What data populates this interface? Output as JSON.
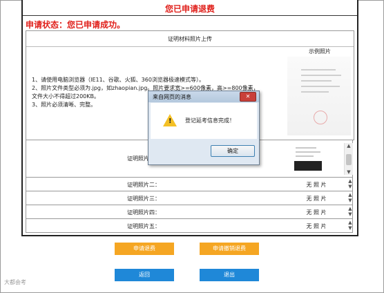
{
  "page": {
    "title": "您已申请退费",
    "status": "申请状态：您已申请成功。"
  },
  "upload_section": {
    "header": "证明材料照片上传",
    "sample_label": "示例照片",
    "instructions": [
      "1、请使用电脑浏览器（IE11、谷歌、火狐、360浏览器极速模式等）。",
      "2、照片文件类型必须为.jpg，如zhaopian.jpg。照片要求宽>=600像素，高>=800像素，",
      "文件大小不得超过200KB。",
      "3、照片必须清晰、完整。"
    ]
  },
  "photos": [
    {
      "label": "证明照片一：",
      "value": ""
    },
    {
      "label": "证明照片二：",
      "value": "无 照 片"
    },
    {
      "label": "证明照片三：",
      "value": "无 照 片"
    },
    {
      "label": "证明照片四：",
      "value": "无 照 片"
    },
    {
      "label": "证明照片五：",
      "value": "无 照 片"
    }
  ],
  "buttons": {
    "refund": "申请退费",
    "cancel_refund": "申请撤销退费",
    "back": "返回",
    "exit": "退出"
  },
  "dialog": {
    "title": "来自网页的消息",
    "message": "登记延考信息完成！",
    "ok": "确定",
    "close": "✕"
  },
  "watermark": "大都会考"
}
